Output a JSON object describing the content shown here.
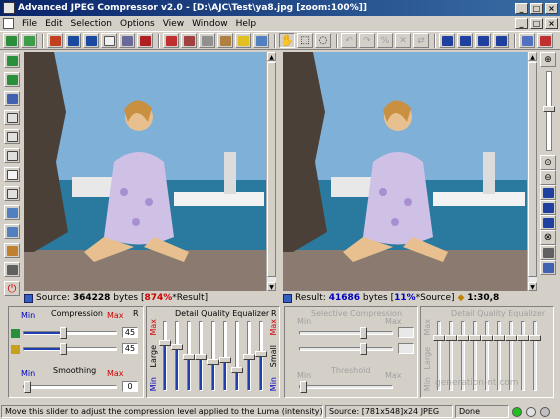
{
  "window": {
    "title": "Advanced JPEG Compressor v2.0 - [D:\\AJC\\Test\\ya8.jpg  [zoom:100%]]"
  },
  "menu": [
    "File",
    "Edit",
    "Selection",
    "Options",
    "View",
    "Window",
    "Help"
  ],
  "toolbar_icons": [
    "open-icon",
    "open-folder-icon",
    "batch-icon",
    "save-icon",
    "save-as-icon",
    "properties-icon",
    "print-icon",
    "tools-icon",
    "copy-icon",
    "paste-icon",
    "crop-icon",
    "resize-icon",
    "colors-icon",
    "export-icon",
    "pan-hand-icon",
    "select-icon",
    "lasso-icon",
    "undo-icon",
    "redo-icon",
    "percent-icon",
    "clear-icon",
    "invert-icon",
    "layout-1-icon",
    "layout-2-icon",
    "layout-3-icon",
    "layout-4-icon",
    "window-icon",
    "help-icon"
  ],
  "left_tools": [
    "compress-icon",
    "recompress-icon",
    "preview-icon",
    "split-view-icon",
    "tile-icon",
    "grid-icon",
    "page-icon",
    "histogram-icon",
    "zoom-in-tool-icon",
    "zoom-out-tool-icon",
    "palette-icon",
    "brush-icon",
    "power-icon"
  ],
  "right_tools": [
    "zoom-fit-icon",
    "zoom-in-icon",
    "zoom-out-icon",
    "view-compare-icon",
    "view-single-icon",
    "view-equalizer-icon",
    "reset-icon",
    "fullscreen-icon",
    "settings-icon"
  ],
  "source_info": {
    "label": "Source:",
    "bytes": "364228",
    "bytes_unit": "bytes",
    "pct": "874%",
    "pct_suffix": "*Result]"
  },
  "result_info": {
    "label": "Result:",
    "bytes": "41686",
    "bytes_unit": "bytes",
    "pct": "11%",
    "pct_suffix": "*Source]",
    "ratio": "1:30,8"
  },
  "compression_panel": {
    "compression_label": "Compression",
    "min": "Min",
    "max": "Max",
    "r": "R",
    "luma_value": "45",
    "chroma_value": "45",
    "luma_level": 0.42,
    "chroma_level": 0.42,
    "smoothing_label": "Smoothing",
    "smoothing_min": "Min",
    "smoothing_max": "Max",
    "smoothing_value": "0",
    "smoothing_level": 0.0
  },
  "equalizer_panel": {
    "title": "Detail Quality Equalizer",
    "max": "Max",
    "min": "Min",
    "large": "Large",
    "small": "Small",
    "r": "R",
    "levels": [
      0.72,
      0.65,
      0.5,
      0.5,
      0.42,
      0.45,
      0.3,
      0.5,
      0.55
    ]
  },
  "selective_panel": {
    "title": "Selective Compression",
    "min": "Min",
    "max": "Max",
    "threshold": "Threshold"
  },
  "selective_equalizer": {
    "title": "Detail Quality Equalizer",
    "max": "Max",
    "min": "Min",
    "large": "Large"
  },
  "status": {
    "hint": "Move this slider to adjust the compression level applied to the Luma (intensity) channel",
    "source": "Source: [781x548]x24 JPEG",
    "state": "Done"
  },
  "watermark": "generation-nt.com",
  "colors": {
    "title_start": "#0a246a",
    "title_end": "#3a6ea5",
    "accent_blue": "#0000c0",
    "accent_red": "#d00000"
  }
}
